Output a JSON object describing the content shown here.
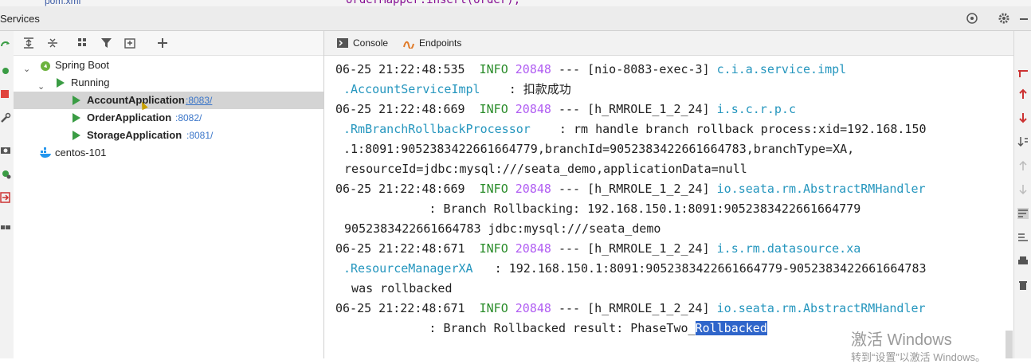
{
  "top": {
    "file_tab": "pom.xml",
    "code_fragment": "orderMapper.insert(order);"
  },
  "header": {
    "title": "Services"
  },
  "tree": {
    "root": "Spring Boot",
    "group": "Running",
    "items": [
      {
        "name": "AccountApplication",
        "port": ":8083/"
      },
      {
        "name": "OrderApplication",
        "port": ":8082/"
      },
      {
        "name": "StorageApplication",
        "port": ":8081/"
      }
    ],
    "docker": "centos-101"
  },
  "console": {
    "tabs": [
      "Console",
      "Endpoints"
    ],
    "lines": [
      {
        "ts": "06-25 21:22:48:535",
        "level": "INFO",
        "pid": "20848",
        "thread": "--- [nio-8083-exec-3]",
        "logger": "c.i.a.service.impl"
      },
      {
        "cont_logger": ".AccountServiceImpl",
        "msg": "    : 扣款成功"
      },
      {
        "ts": "06-25 21:22:48:669",
        "level": "INFO",
        "pid": "20848",
        "thread": "--- [h_RMROLE_1_2_24]",
        "logger": "i.s.c.r.p.c"
      },
      {
        "cont_logger": ".RmBranchRollbackProcessor",
        "msg": "    : rm handle branch rollback process:xid=192.168.150"
      },
      {
        "msg": ".1:8091:9052383422661664779,branchId=9052383422661664783,branchType=XA,"
      },
      {
        "msg": " resourceId=jdbc:mysql:///seata_demo,applicationData=null"
      },
      {
        "ts": "06-25 21:22:48:669",
        "level": "INFO",
        "pid": "20848",
        "thread": "--- [h_RMROLE_1_2_24]",
        "logger": "io.seata.rm.AbstractRMHandler"
      },
      {
        "msg": "             : Branch Rollbacking: 192.168.150.1:8091:9052383422661664779"
      },
      {
        "msg": " 9052383422661664783 jdbc:mysql:///seata_demo"
      },
      {
        "ts": "06-25 21:22:48:671",
        "level": "INFO",
        "pid": "20848",
        "thread": "--- [h_RMROLE_1_2_24]",
        "logger": "i.s.rm.datasource.xa"
      },
      {
        "cont_logger": ".ResourceManagerXA",
        "msg": "   : 192.168.150.1:8091:9052383422661664779-9052383422661664783"
      },
      {
        "msg": "  was rollbacked"
      },
      {
        "ts": "06-25 21:22:48:671",
        "level": "INFO",
        "pid": "20848",
        "thread": "--- [h_RMROLE_1_2_24]",
        "logger": "io.seata.rm.AbstractRMHandler"
      },
      {
        "msg": "             : Branch Rollbacked result: PhaseTwo_",
        "selected": "Rollbacked"
      }
    ]
  },
  "watermark": {
    "line1": "激活 Windows",
    "line2": "转到“设置”以激活 Windows。"
  },
  "colors": {
    "info": "#2a8c2a",
    "pid": "#b05df2",
    "logger": "#2596be",
    "selection": "#2f65ca"
  }
}
